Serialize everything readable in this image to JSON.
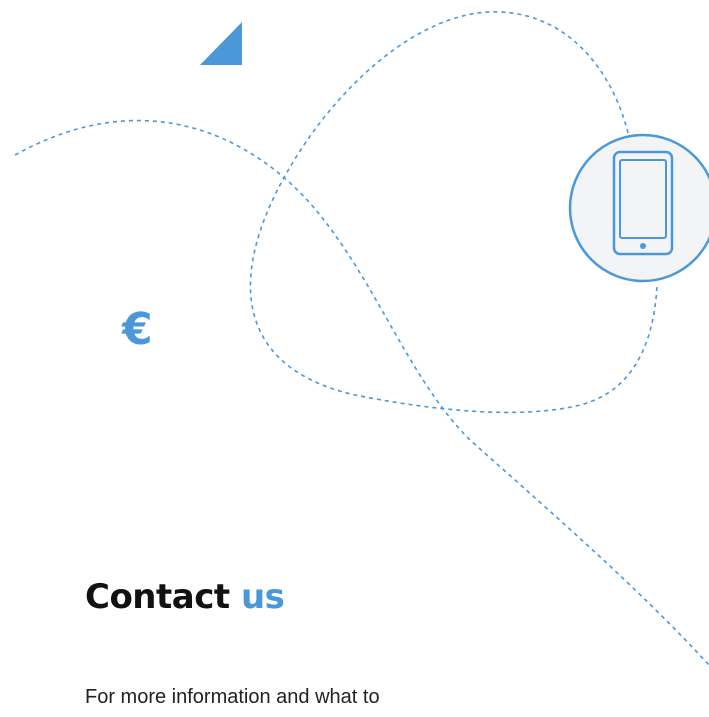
{
  "heading": {
    "word1": "Contact",
    "word2": "us"
  },
  "body": {
    "intro": "For more information and what to"
  },
  "decor": {
    "currency_symbol": "€",
    "device_icon": "smartphone-icon",
    "corner_shape": "triangle-shape",
    "accent_color": "#4a98d9",
    "circle_fill": "#f3f4f6"
  }
}
